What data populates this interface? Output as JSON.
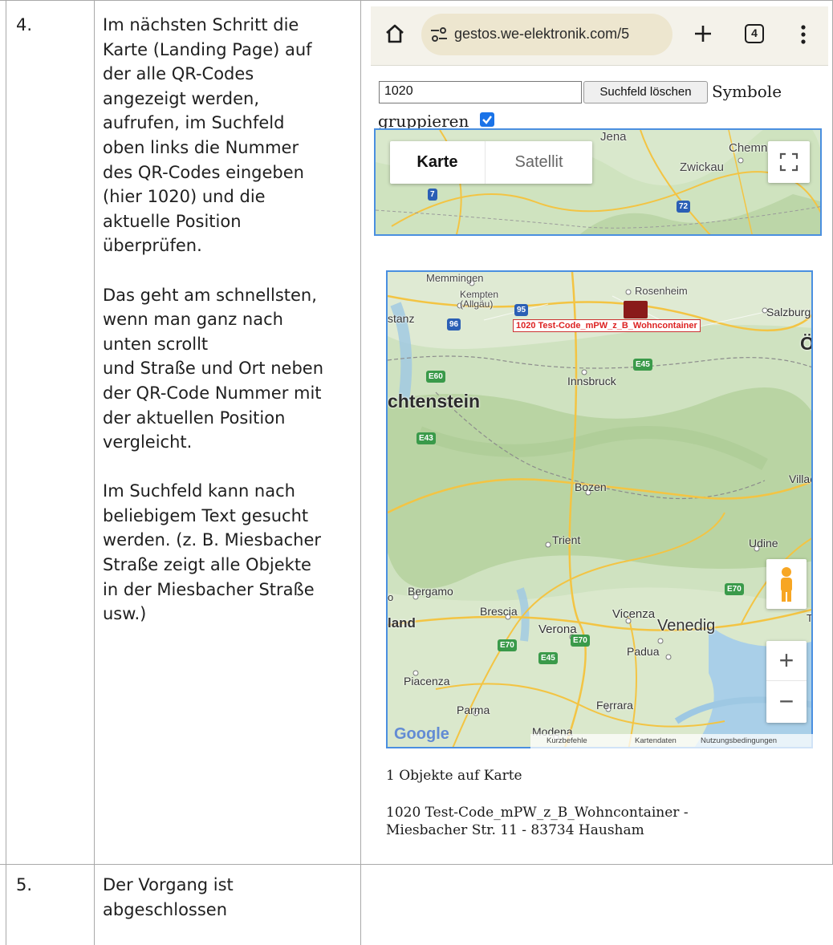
{
  "rows": [
    {
      "number": "4.",
      "text": "Im nächsten Schritt die\nKarte (Landing Page) auf\nder alle QR-Codes\nangezeigt werden,\naufrufen, im Suchfeld\noben links die Nummer\ndes QR-Codes eingeben\n(hier 1020) und die\naktuelle Position\nüberprüfen.\n\nDas geht am schnellsten,\nwenn man ganz nach\nunten scrollt\nund Straße und Ort neben\nder QR-Code Nummer mit\nder aktuellen Position\nvergleicht.\n\nIm Suchfeld kann nach\nbeliebigem Text gesucht\nwerden. (z. B. Miesbacher\nStraße zeigt alle Objekte\nin der Miesbacher Straße\nusw.)"
    },
    {
      "number": "5.",
      "text": "Der Vorgang ist\nabgeschlossen"
    }
  ],
  "browser": {
    "url": "gestos.we-elektronik.com/5",
    "tab_count": "4",
    "home_icon": "home-icon",
    "site_settings_icon": "site-settings-icon",
    "new_tab_icon": "plus-icon",
    "menu_icon": "more-vert-icon"
  },
  "search": {
    "value": "1020",
    "clear_button": "Suchfeld löschen",
    "group_label_1": "Symbole",
    "group_label_2": "gruppieren",
    "group_checked": true
  },
  "map_small": {
    "map_type_map": "Karte",
    "map_type_satellite": "Satellit",
    "labels": [
      "Jena",
      "Chemnit",
      "Zwickau"
    ],
    "shields": [
      "7",
      "72"
    ]
  },
  "map_big": {
    "cities": [
      "Memmingen",
      "Kempten\n(Allgäu)",
      "Rosenheim",
      "Salzburg",
      "stanz",
      "Innsbruck",
      "chtenstein",
      "Bozen",
      "Villac",
      "Trient",
      "Udine",
      "Bergamo",
      "Brescia",
      "Vicenza",
      "land",
      "Verona",
      "Venedig",
      "Padua",
      "Piacenza",
      "Parma",
      "Ferrara",
      "Modena",
      "Ö",
      "o",
      "T"
    ],
    "shields": [
      "95",
      "96",
      "E60",
      "E45",
      "E43",
      "E70",
      "E70",
      "E70",
      "E45"
    ],
    "marker_label": "1020 Test-Code_mPW_z_B_Wohncontainer",
    "google": "Google",
    "attribution": [
      "Kurzbefehle",
      "Kartendaten",
      "Nutzungsbedingungen"
    ],
    "zoom_in": "+",
    "zoom_out": "−"
  },
  "results": {
    "count_text": "1 Objekte auf Karte",
    "entry_line1": "1020 Test-Code_mPW_z_B_Wohncontainer -",
    "entry_line2": "Miesbacher Str. 11 - 83734 Hausham"
  },
  "colors": {
    "map_border": "#4a8fe0",
    "checkbox": "#1a73e8",
    "marker_text": "#d22222"
  }
}
